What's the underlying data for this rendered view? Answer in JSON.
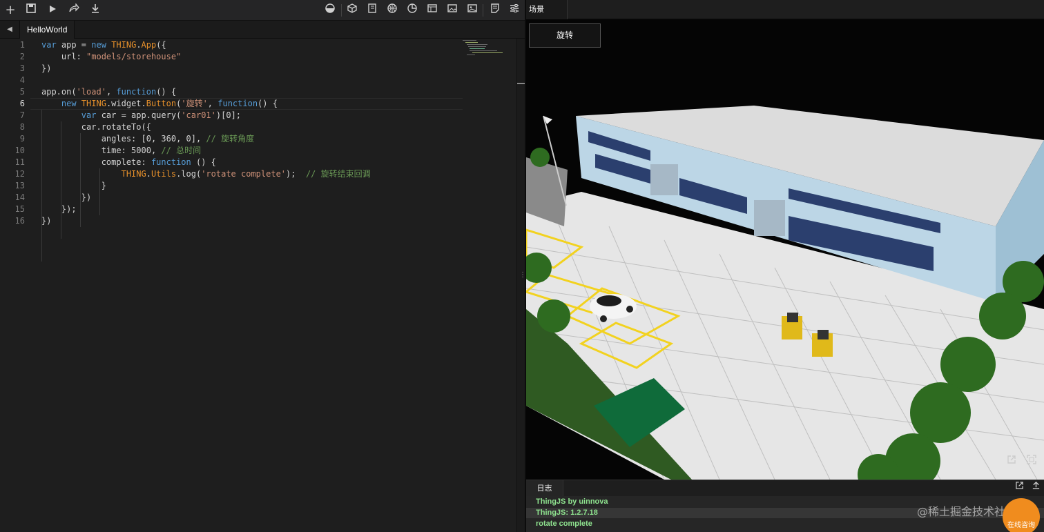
{
  "toolbar": {
    "left_icons": [
      "plus-icon",
      "save-icon",
      "play-icon",
      "share-icon",
      "download-icon"
    ],
    "right_icons": [
      "contrast-icon",
      "cube-icon",
      "book-icon",
      "basketball-icon",
      "pie-icon",
      "layout-icon",
      "picture-icon",
      "image-icon",
      "note-icon",
      "settings-icon"
    ]
  },
  "editor": {
    "tab_label": "HelloWorld",
    "line_numbers": [
      "1",
      "2",
      "3",
      "4",
      "5",
      "6",
      "7",
      "8",
      "9",
      "10",
      "11",
      "12",
      "13",
      "14",
      "15",
      "16"
    ],
    "active_line": "6",
    "code": {
      "l1": {
        "a": "var",
        "b": " app = ",
        "c": "new",
        "d": " ",
        "e": "THING",
        "f": ".",
        "g": "App",
        "h": "({"
      },
      "l2": {
        "a": "    url: ",
        "b": "\"models/storehouse\""
      },
      "l3": {
        "a": "})"
      },
      "l5": {
        "a": "app.on(",
        "b": "'load'",
        "c": ", ",
        "d": "function",
        "e": "() {"
      },
      "l6": {
        "a": "    ",
        "b": "new",
        "c": " ",
        "d": "THING",
        "e": ".widget.",
        "f": "Button",
        "g": "(",
        "h": "'旋转'",
        "i": ", ",
        "j": "function",
        "k": "() {"
      },
      "l7": {
        "a": "        ",
        "b": "var",
        "c": " car = app.query(",
        "d": "'car01'",
        "e": ")[0];"
      },
      "l8": {
        "a": "        car.rotateTo({"
      },
      "l9": {
        "a": "            angles: [0, 360, 0], ",
        "b": "// 旋转角度"
      },
      "l10": {
        "a": "            time: 5000, ",
        "b": "// 总时间"
      },
      "l11": {
        "a": "            complete: ",
        "b": "function",
        "c": " () {"
      },
      "l12": {
        "a": "                ",
        "b": "THING",
        "c": ".",
        "d": "Utils",
        "e": ".log(",
        "f": "'rotate complete'",
        "g": ");  ",
        "h": "// 旋转结束回调"
      },
      "l13": {
        "a": "            }"
      },
      "l14": {
        "a": "        })"
      },
      "l15": {
        "a": "    });"
      },
      "l16": {
        "a": "})"
      }
    }
  },
  "scene": {
    "tab_label": "场景",
    "rotate_button": "旋转",
    "open_external_icon": "external-link-icon",
    "fullscreen_icon": "fullscreen-icon"
  },
  "log": {
    "tab_label": "日志",
    "lines": [
      "ThingJS by uinnova",
      "ThingJS: 1.2.7.18",
      "rotate complete"
    ]
  },
  "overlay": {
    "watermark": "@稀土掘金技术社区",
    "consult_label": "在线咨询"
  }
}
